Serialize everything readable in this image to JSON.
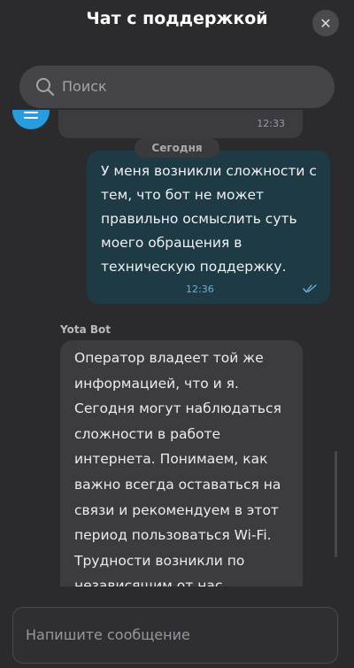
{
  "header": {
    "title": "Чат с поддержкой",
    "close_symbol": "✕"
  },
  "search": {
    "placeholder": "Поиск"
  },
  "chat": {
    "previous_message": {
      "time": "12:33"
    },
    "date_separator": "Сегодня",
    "user_message": {
      "text": "У меня возникли сложности с тем, что бот не может правильно осмыслить суть моего обращения в техническую поддержку.",
      "time": "12:36",
      "status": "read"
    },
    "bot_message": {
      "sender": "Yota Bot",
      "text": "Оператор владеет той же информацией, что и я. Сегодня могут наблюдаться сложности в работе интернета. Понимаем, как важно всегда оставаться на связи и рекомендуем в этот период пользоваться Wi-Fi. Трудности возникли по независящим от нас"
    }
  },
  "composer": {
    "placeholder": "Напишите сообщение"
  },
  "colors": {
    "background": "#2b2b2e",
    "user_bubble": "#1e3a44",
    "bot_bubble": "#3c3c40",
    "read_ticks": "#6fb0d6",
    "avatar": "#2b9be0"
  }
}
